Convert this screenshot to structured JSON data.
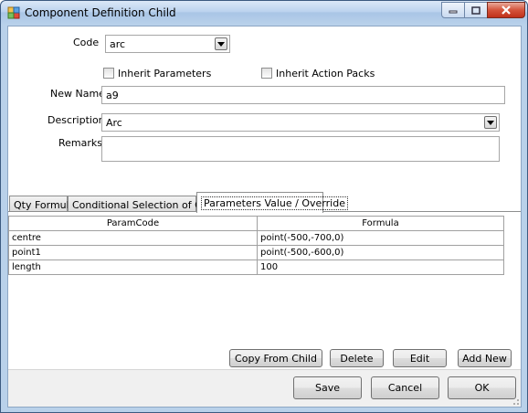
{
  "window": {
    "title": "Component Definition Child"
  },
  "form": {
    "code_label": "Code",
    "code_value": "arc",
    "inherit_parameters_label": "Inherit Parameters",
    "inherit_action_packs_label": "Inherit Action Packs",
    "new_name_label": "New Name",
    "new_name_value": "a9",
    "description_label": "Description",
    "description_value": "Arc",
    "remarks_label": "Remarks",
    "remarks_value": ""
  },
  "tabs": [
    {
      "label": "Qty Formula"
    },
    {
      "label": "Conditional Selection of Child"
    },
    {
      "label": "Parameters Value / Override"
    }
  ],
  "grid": {
    "headers": [
      "ParamCode",
      "Formula"
    ],
    "rows": [
      [
        "centre",
        "point(-500,-700,0)"
      ],
      [
        "point1",
        "point(-500,-600,0)"
      ],
      [
        "length",
        "100"
      ]
    ]
  },
  "grid_buttons": {
    "copy_from_child": "Copy From Child",
    "delete": "Delete",
    "edit": "Edit",
    "add_new": "Add New"
  },
  "footer_buttons": {
    "save": "Save",
    "cancel": "Cancel",
    "ok": "OK"
  },
  "icons": {
    "app": "app-icon",
    "minimize": "minimize-icon",
    "maximize": "maximize-icon",
    "close": "close-icon",
    "dropdown": "chevron-down-icon",
    "resize": "resize-grip-icon"
  },
  "colors": {
    "title_bar": "#b9d1ea",
    "close_button": "#c0301a",
    "client_bg": "#ffffff",
    "footer_bg": "#f0f0f0"
  }
}
